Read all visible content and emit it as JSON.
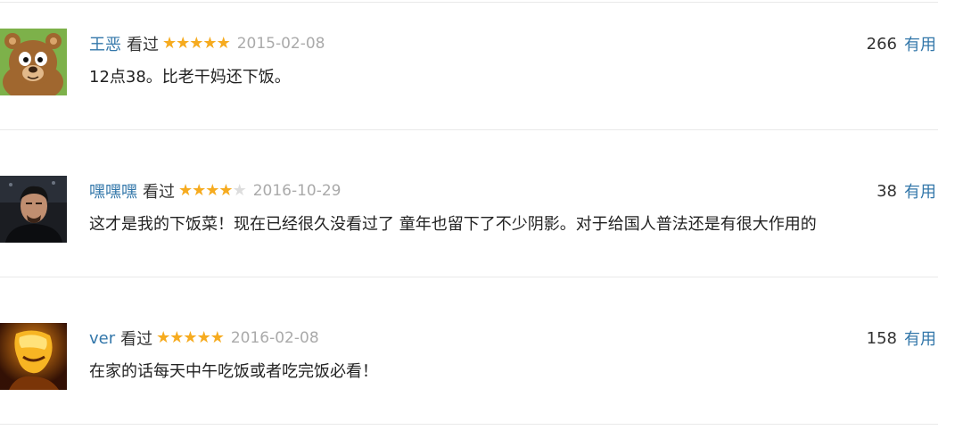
{
  "reviews": [
    {
      "username": "王恶",
      "watched": "看过",
      "rating": 5,
      "date": "2015-02-08",
      "votes": "266",
      "useful": "有用",
      "comment": "12点38。比老干妈还下饭。",
      "avatar": "cartoon-bear-avatar"
    },
    {
      "username": "嘿嘿嘿",
      "watched": "看过",
      "rating": 4,
      "date": "2016-10-29",
      "votes": "38",
      "useful": "有用",
      "comment": "这才是我的下饭菜！现在已经很久没看过了 童年也留下了不少阴影。对于给国人普法还是有很大作用的",
      "avatar": "man-portrait-avatar"
    },
    {
      "username": "ver",
      "watched": "看过",
      "rating": 5,
      "date": "2016-02-08",
      "votes": "158",
      "useful": "有用",
      "comment": "在家的话每天中午吃饭或者吃完饭必看！",
      "avatar": "glowing-figure-avatar"
    }
  ],
  "colors": {
    "link": "#3377aa",
    "star": "#f6ab1f",
    "star_empty": "#dddddd",
    "date": "#aaaaaa",
    "divider": "#e9e9e9"
  }
}
